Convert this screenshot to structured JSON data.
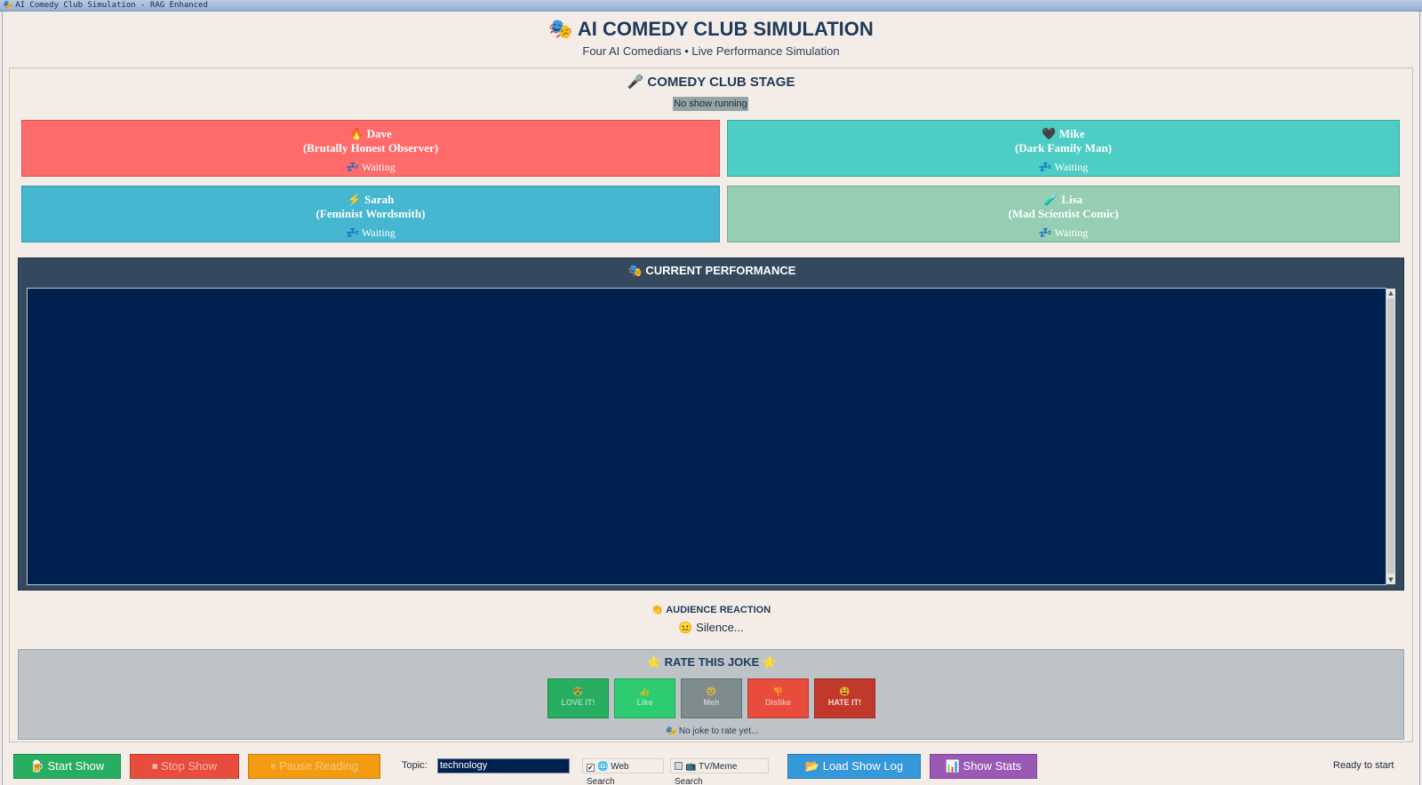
{
  "window": {
    "title": "AI Comedy Club Simulation - RAG Enhanced",
    "icon": "masks-icon"
  },
  "header": {
    "title": "🎭 AI COMEDY CLUB SIMULATION",
    "subtitle": "Four AI Comedians • Live Performance Simulation"
  },
  "stage": {
    "title": "🎤 COMEDY CLUB STAGE",
    "status": "No show running",
    "comedians": [
      {
        "name": "🔥 Dave",
        "role": "(Brutally Honest Observer)",
        "status": "💤 Waiting",
        "color": "#ff6b6b"
      },
      {
        "name": "🖤 Mike",
        "role": "(Dark Family Man)",
        "status": "💤 Waiting",
        "color": "#4ecdc4"
      },
      {
        "name": "⚡ Sarah",
        "role": "(Feminist Wordsmith)",
        "status": "💤 Waiting",
        "color": "#45b7d1"
      },
      {
        "name": "🧪 Lisa",
        "role": "(Mad Scientist Comic)",
        "status": "💤 Waiting",
        "color": "#96ceb4"
      }
    ]
  },
  "performance": {
    "title": "🎭 CURRENT PERFORMANCE",
    "text": ""
  },
  "audience": {
    "title": "👏 AUDIENCE REACTION",
    "reaction": "😐 Silence..."
  },
  "rating": {
    "title": "⭐ RATE THIS JOKE ⭐",
    "buttons": [
      {
        "icon": "😍",
        "label": "LOVE IT!",
        "color": "#27ae60"
      },
      {
        "icon": "👍",
        "label": "Like",
        "color": "#2ecc71"
      },
      {
        "icon": "😐",
        "label": "Meh",
        "color": "#7f8c8d"
      },
      {
        "icon": "👎",
        "label": "Dislike",
        "color": "#e74c3c"
      },
      {
        "icon": "😫",
        "label": "HATE IT!",
        "color": "#c0392b"
      }
    ],
    "status": "🎭 No joke to rate yet..."
  },
  "controls": {
    "start_label": "🍺 Start Show",
    "stop_label": "⏹ Stop Show",
    "pause_label": "⏸ Pause Reading",
    "topic_label": "Topic:",
    "topic_value": "technology",
    "web_search_label": "🌐 Web Search",
    "web_search_checked": "✔",
    "tv_meme_label": "📺 TV/Meme Search",
    "load_label": "📂 Load Show Log",
    "stats_label": "📊 Show Stats",
    "status_text": "Ready to start"
  }
}
